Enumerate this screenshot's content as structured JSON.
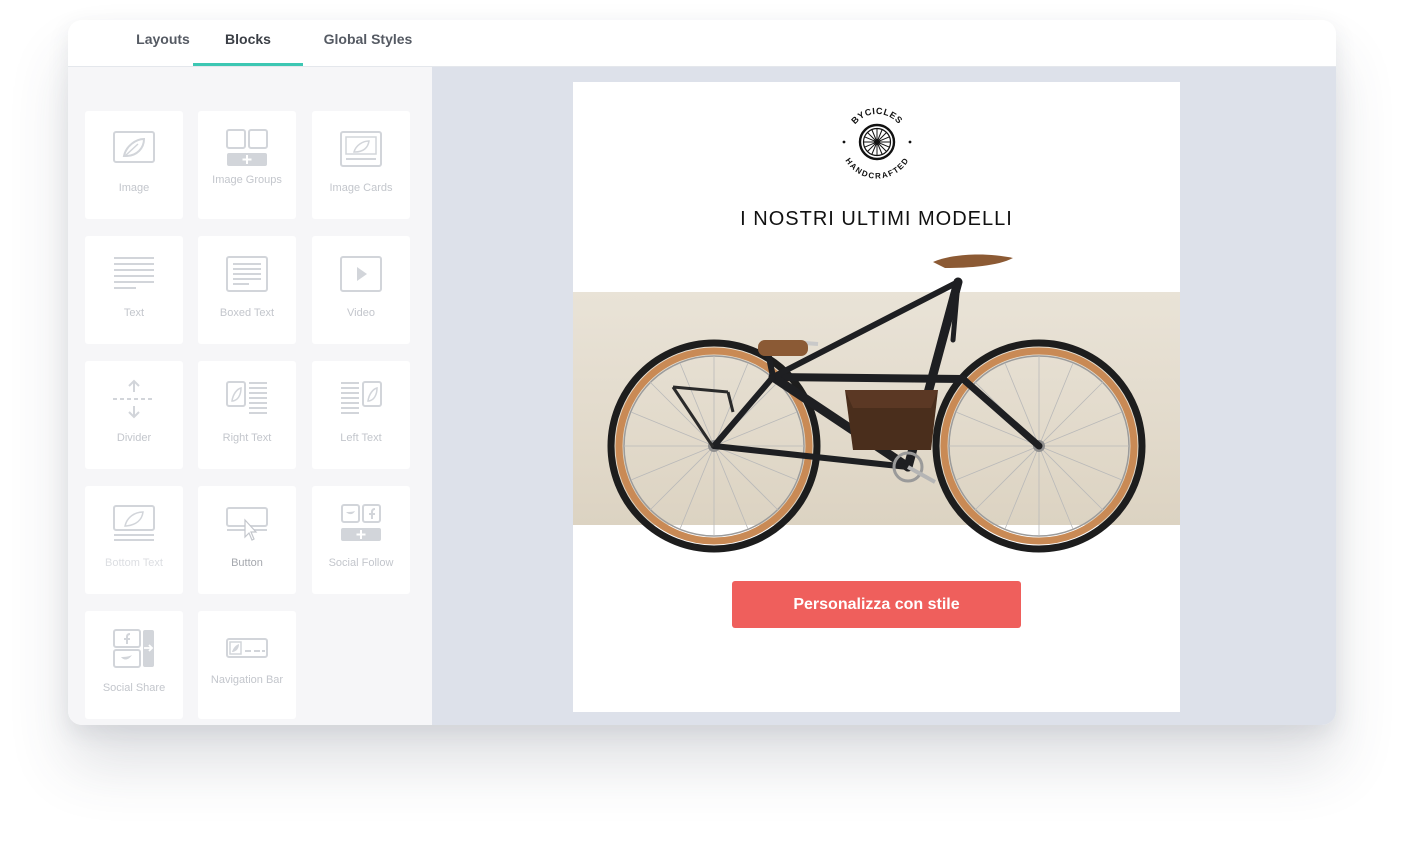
{
  "tabs": [
    {
      "label": "Layouts"
    },
    {
      "label": "Blocks",
      "active": true
    },
    {
      "label": "Global Styles"
    }
  ],
  "blocks": [
    {
      "label": "Image",
      "icon": "image-icon"
    },
    {
      "label": "Image Groups",
      "icon": "image-groups-icon"
    },
    {
      "label": "Image Cards",
      "icon": "image-cards-icon"
    },
    {
      "label": "Text",
      "icon": "text-icon"
    },
    {
      "label": "Boxed Text",
      "icon": "boxed-text-icon"
    },
    {
      "label": "Video",
      "icon": "video-icon"
    },
    {
      "label": "Divider",
      "icon": "divider-icon"
    },
    {
      "label": "Right Text",
      "icon": "right-text-icon"
    },
    {
      "label": "Left Text",
      "icon": "left-text-icon"
    },
    {
      "label": "Bottom Text",
      "icon": "bottom-text-icon"
    },
    {
      "label": "Button",
      "icon": "button-icon"
    },
    {
      "label": "Social Follow",
      "icon": "social-follow-icon"
    },
    {
      "label": "Social Share",
      "icon": "social-share-icon"
    },
    {
      "label": "Navigation Bar",
      "icon": "navigation-bar-icon"
    }
  ],
  "email": {
    "logo_top": "BYCICLES",
    "logo_bottom": "HANDCRAFTED",
    "headline": "I NOSTRI ULTIMI MODELLI",
    "cta_label": "Personalizza con stile"
  },
  "colors": {
    "accent": "#3dc7b3",
    "cta": "#ef5f5c",
    "canvas_bg": "#dde1ea",
    "sidebar_bg": "#f6f6f8"
  }
}
